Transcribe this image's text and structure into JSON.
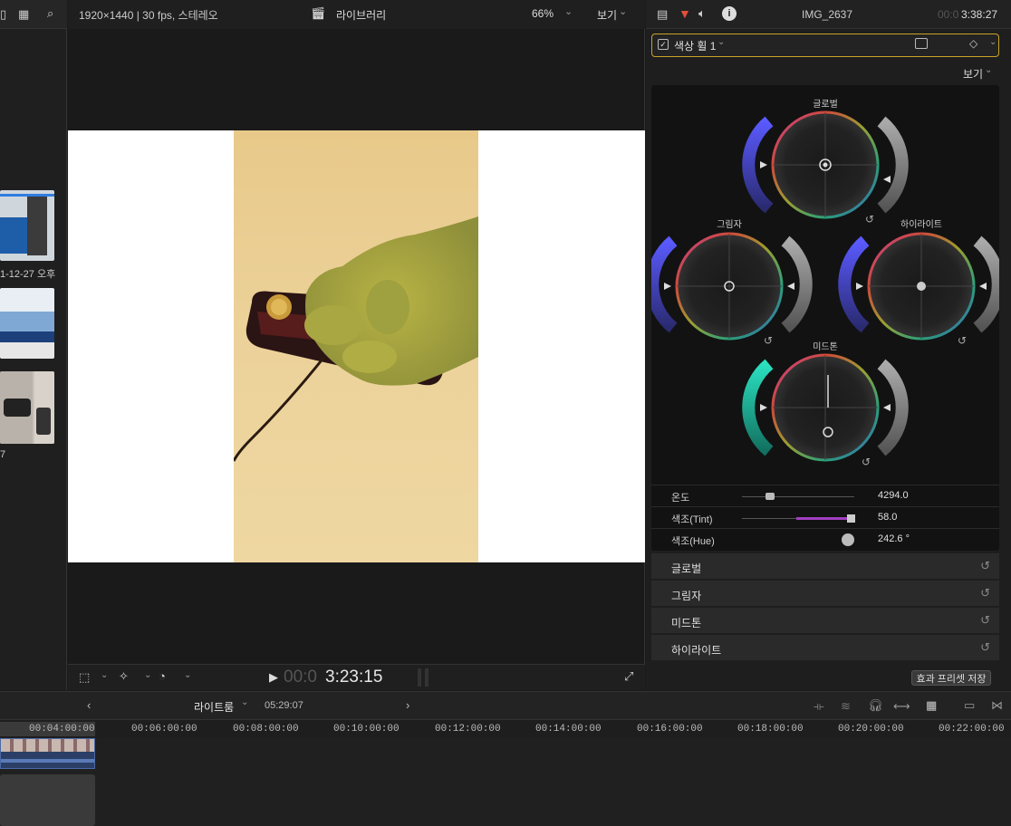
{
  "browser": {
    "items": [
      {
        "label": "1-12-27 오후"
      },
      {
        "label": ""
      },
      {
        "label": "7"
      }
    ]
  },
  "viewer": {
    "format": "1920×1440 | 30 fps, 스테레오",
    "library": "라이브러리",
    "zoom": "66%",
    "view_menu": "보기",
    "timecode_dim": "00:0",
    "timecode": "3:23:15"
  },
  "inspector": {
    "clip_name": "IMG_2637",
    "timecode_dim": "00:0",
    "timecode": "3:38:27",
    "effect_name": "색상 휠 1",
    "view_menu": "보기",
    "wheels": {
      "global": "글로벌",
      "shadows": "그림자",
      "highlights": "하이라이트",
      "midtones": "미드톤"
    },
    "sliders": [
      {
        "label": "온도",
        "value": "4294.0"
      },
      {
        "label": "색조(Tint)",
        "value": "58.0"
      },
      {
        "label": "색조(Hue)",
        "value": "242.6 °"
      }
    ],
    "sections": [
      "글로벌",
      "그림자",
      "미드톤",
      "하이라이트"
    ],
    "save_preset": "효과 프리셋 저장"
  },
  "timeline": {
    "name": "라이트룸",
    "duration": "05:29:07",
    "ticks": [
      "00:04:00:00",
      "00:06:00:00",
      "00:08:00:00",
      "00:10:00:00",
      "00:12:00:00",
      "00:14:00:00",
      "00:16:00:00",
      "00:18:00:00",
      "00:20:00:00",
      "00:22:00:00"
    ]
  },
  "colors": {
    "accent": "#c9a227",
    "panel": "#1e1e1e"
  }
}
